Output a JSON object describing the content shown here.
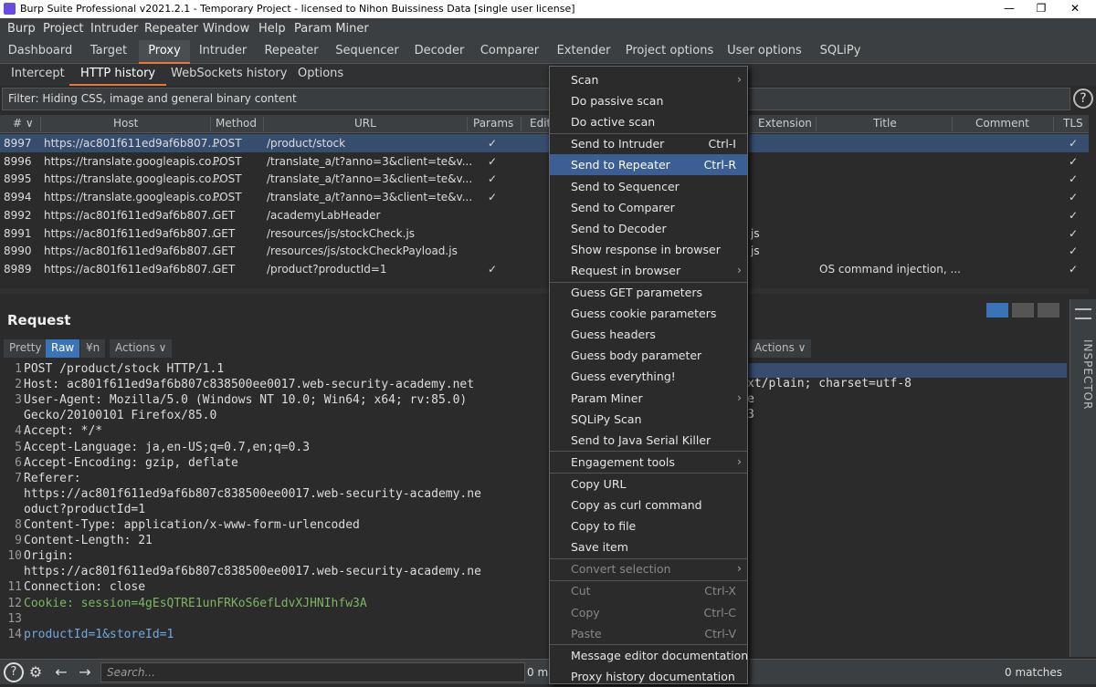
{
  "titlebar": {
    "title": "Burp Suite Professional v2021.2.1 - Temporary Project - licensed to Nihon Buissiness Data [single user license]"
  },
  "menubar": [
    "Burp",
    "Project",
    "Intruder",
    "Repeater",
    "Window",
    "Help",
    "Param Miner"
  ],
  "tabs": [
    "Dashboard",
    "Target",
    "Proxy",
    "Intruder",
    "Repeater",
    "Sequencer",
    "Decoder",
    "Comparer",
    "Extender",
    "Project options",
    "User options",
    "SQLiPy"
  ],
  "subtabs": [
    "Intercept",
    "HTTP history",
    "WebSockets history",
    "Options"
  ],
  "filter": "Filter: Hiding CSS, image and general binary content",
  "columns": {
    "num": "# ∨",
    "host": "Host",
    "method": "Method",
    "url": "URL",
    "params": "Params",
    "edit": "Edit",
    "extension": "Extension",
    "title": "Title",
    "comment": "Comment",
    "tls": "TLS"
  },
  "rows": [
    {
      "num": "8997",
      "host": "https://ac801f611ed9af6b807...",
      "method": "POST",
      "url": "/product/stock",
      "params": "✓",
      "ext": "",
      "title": "",
      "tls": "✓"
    },
    {
      "num": "8996",
      "host": "https://translate.googleapis.co...",
      "method": "POST",
      "url": "/translate_a/t?anno=3&client=te&v...",
      "params": "✓",
      "ext": "",
      "title": "",
      "tls": "✓"
    },
    {
      "num": "8995",
      "host": "https://translate.googleapis.co...",
      "method": "POST",
      "url": "/translate_a/t?anno=3&client=te&v...",
      "params": "✓",
      "ext": "",
      "title": "",
      "tls": "✓"
    },
    {
      "num": "8994",
      "host": "https://translate.googleapis.co...",
      "method": "POST",
      "url": "/translate_a/t?anno=3&client=te&v...",
      "params": "✓",
      "ext": "",
      "title": "",
      "tls": "✓"
    },
    {
      "num": "8992",
      "host": "https://ac801f611ed9af6b807...",
      "method": "GET",
      "url": "/academyLabHeader",
      "params": "",
      "ext": "",
      "title": "",
      "tls": "✓"
    },
    {
      "num": "8991",
      "host": "https://ac801f611ed9af6b807...",
      "method": "GET",
      "url": "/resources/js/stockCheck.js",
      "params": "",
      "ext": "js",
      "title": "",
      "tls": "✓"
    },
    {
      "num": "8990",
      "host": "https://ac801f611ed9af6b807...",
      "method": "GET",
      "url": "/resources/js/stockCheckPayload.js",
      "params": "",
      "ext": "js",
      "title": "",
      "tls": "✓"
    },
    {
      "num": "8989",
      "host": "https://ac801f611ed9af6b807...",
      "method": "GET",
      "url": "/product?productId=1",
      "params": "✓",
      "ext": "",
      "title": "OS command injection, ...",
      "tls": "✓"
    }
  ],
  "request": {
    "title": "Request",
    "pretty": "Pretty",
    "raw": "Raw",
    "newline": "¥n",
    "actions": "Actions ∨",
    "lines": [
      {
        "n": "1",
        "t": "POST /product/stock HTTP/1.1"
      },
      {
        "n": "2",
        "t": "Host: ac801f611ed9af6b807c838500ee0017.web-security-academy.net"
      },
      {
        "n": "3",
        "t": "User-Agent: Mozilla/5.0 (Windows NT 10.0; Win64; x64; rv:85.0)"
      },
      {
        "n": "",
        "t": "Gecko/20100101 Firefox/85.0"
      },
      {
        "n": "4",
        "t": "Accept: */*"
      },
      {
        "n": "5",
        "t": "Accept-Language: ja,en-US;q=0.7,en;q=0.3"
      },
      {
        "n": "6",
        "t": "Accept-Encoding: gzip, deflate"
      },
      {
        "n": "7",
        "t": "Referer:"
      },
      {
        "n": "",
        "t": "https://ac801f611ed9af6b807c838500ee0017.web-security-academy.ne"
      },
      {
        "n": "",
        "t": "oduct?productId=1"
      },
      {
        "n": "8",
        "t": "Content-Type: application/x-www-form-urlencoded"
      },
      {
        "n": "9",
        "t": "Content-Length: 21"
      },
      {
        "n": "10",
        "t": "Origin:"
      },
      {
        "n": "",
        "t": "https://ac801f611ed9af6b807c838500ee0017.web-security-academy.ne"
      },
      {
        "n": "11",
        "t": "Connection: close"
      },
      {
        "n": "12",
        "t": "Cookie: session=4gEsQTRE1unFRKoS6efLdvXJHNIhfw3A"
      },
      {
        "n": "13",
        "t": ""
      },
      {
        "n": "14",
        "t": "productId=1&storeId=1"
      }
    ]
  },
  "response": {
    "actions": "Actions ∨",
    "lines": [
      "xt/plain; charset=utf-8",
      "e",
      "3"
    ]
  },
  "inspector": "INSPECTOR",
  "bottom": {
    "search_placeholder": "Search...",
    "matches_left": "0 ma",
    "matches_right": "0 matches"
  },
  "context_menu": [
    {
      "label": "Scan",
      "sc": "",
      "arrow": true
    },
    {
      "label": "Do passive scan",
      "sc": ""
    },
    {
      "label": "Do active scan",
      "sc": ""
    },
    {
      "sep": true
    },
    {
      "label": "Send to Intruder",
      "sc": "Ctrl-I"
    },
    {
      "label": "Send to Repeater",
      "sc": "Ctrl-R",
      "hl": true
    },
    {
      "label": "Send to Sequencer",
      "sc": ""
    },
    {
      "label": "Send to Comparer",
      "sc": ""
    },
    {
      "label": "Send to Decoder",
      "sc": ""
    },
    {
      "label": "Show response in browser",
      "sc": ""
    },
    {
      "label": "Request in browser",
      "sc": "",
      "arrow": true
    },
    {
      "sep": true
    },
    {
      "label": "Guess GET parameters",
      "sc": ""
    },
    {
      "label": "Guess cookie parameters",
      "sc": ""
    },
    {
      "label": "Guess headers",
      "sc": ""
    },
    {
      "label": "Guess body parameter",
      "sc": ""
    },
    {
      "label": "Guess everything!",
      "sc": ""
    },
    {
      "label": "Param Miner",
      "sc": "",
      "arrow": true
    },
    {
      "label": "SQLiPy Scan",
      "sc": ""
    },
    {
      "label": "Send to Java Serial Killer",
      "sc": ""
    },
    {
      "sep": true
    },
    {
      "label": "Engagement tools",
      "sc": "",
      "arrow": true
    },
    {
      "sep": true
    },
    {
      "label": "Copy URL",
      "sc": ""
    },
    {
      "label": "Copy as curl command",
      "sc": ""
    },
    {
      "label": "Copy to file",
      "sc": ""
    },
    {
      "label": "Save item",
      "sc": ""
    },
    {
      "sep": true
    },
    {
      "label": "Convert selection",
      "sc": "",
      "arrow": true,
      "dis": true
    },
    {
      "sep": true
    },
    {
      "label": "Cut",
      "sc": "Ctrl-X",
      "dis": true
    },
    {
      "label": "Copy",
      "sc": "Ctrl-C",
      "dis": true
    },
    {
      "label": "Paste",
      "sc": "Ctrl-V",
      "dis": true
    },
    {
      "sep": true
    },
    {
      "label": "Message editor documentation",
      "sc": ""
    },
    {
      "label": "Proxy history documentation",
      "sc": ""
    }
  ]
}
